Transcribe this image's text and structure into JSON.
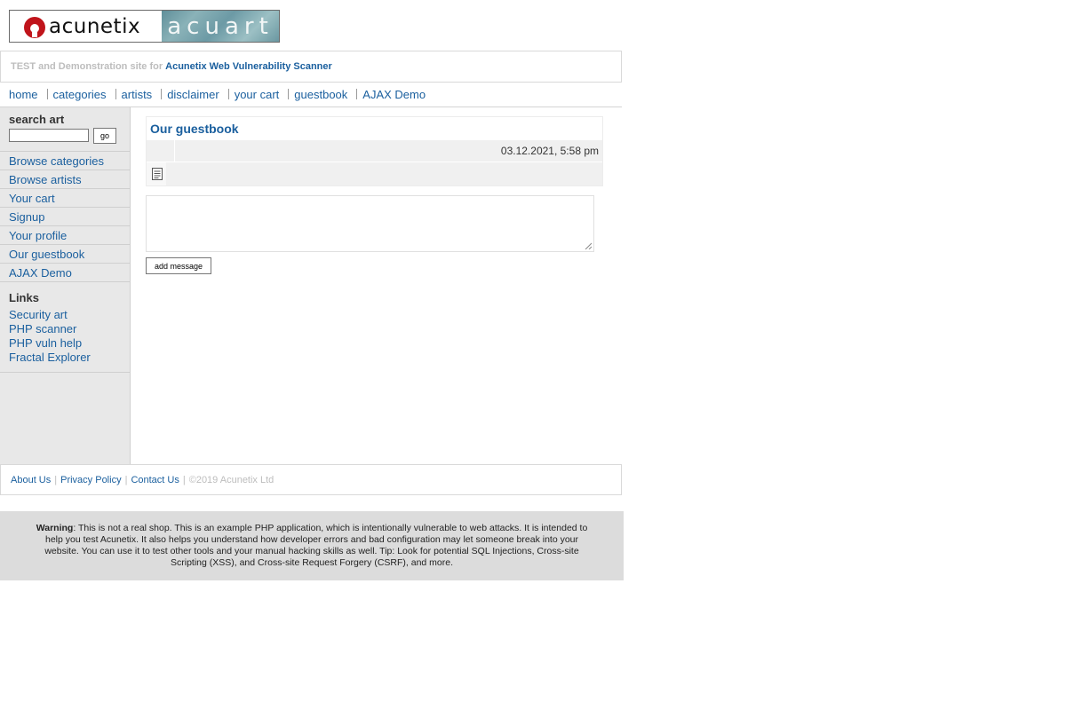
{
  "logo": {
    "left_word": "acunetix",
    "right_word": "acuart"
  },
  "topstrip": {
    "prefix": "TEST and Demonstration site for",
    "brand": "Acunetix Web Vulnerability Scanner"
  },
  "nav": [
    "home",
    "categories",
    "artists",
    "disclaimer",
    "your cart",
    "guestbook",
    "AJAX Demo"
  ],
  "search": {
    "title": "search art",
    "input_value": "",
    "go_label": "go"
  },
  "side_menu": [
    "Browse categories",
    "Browse artists",
    "Your cart",
    "Signup",
    "Your profile",
    "Our guestbook",
    "AJAX Demo"
  ],
  "links": {
    "title": "Links",
    "items": [
      "Security art",
      "PHP scanner",
      "PHP vuln help",
      "Fractal Explorer"
    ]
  },
  "guestbook": {
    "title": "Our guestbook",
    "entry_date": "03.12.2021, 5:58 pm"
  },
  "message_form": {
    "textarea_value": "",
    "add_label": "add message"
  },
  "footer": {
    "links": [
      "About Us",
      "Privacy Policy",
      "Contact Us"
    ],
    "copyright": "©2019 Acunetix Ltd"
  },
  "warning": {
    "label": "Warning",
    "text": ": This is not a real shop. This is an example PHP application, which is intentionally vulnerable to web attacks. It is intended to help you test Acunetix. It also helps you understand how developer errors and bad configuration may let someone break into your website. You can use it to test other tools and your manual hacking skills as well. Tip: Look for potential SQL Injections, Cross-site Scripting (XSS), and Cross-site Request Forgery (CSRF), and more."
  },
  "colors": {
    "link": "#1a5f9e",
    "muted": "#bdbdbd",
    "sidebar_bg": "#e8e8e8",
    "warning_bg": "#dcdcdc",
    "logo_red": "#c0141b"
  },
  "icons": {
    "logo_mark": "acunetix-logo-icon",
    "entry": "document-icon"
  }
}
